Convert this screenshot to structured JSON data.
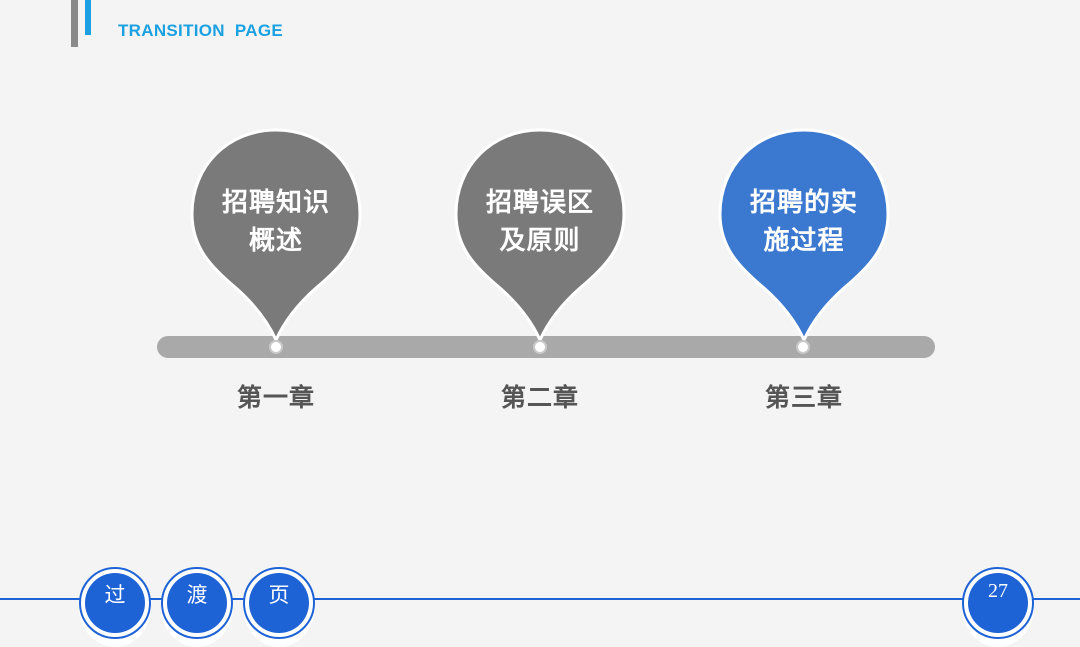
{
  "header": {
    "title": "TRANSITION  PAGE"
  },
  "colors": {
    "accent": "#1ba1e2",
    "primary": "#1e63d6",
    "pin_gray": "#7a7a7a",
    "pin_active": "#3b78cf",
    "timeline": "#a9a9a9"
  },
  "milestones": [
    {
      "line1": "招聘知识",
      "line2": "概述",
      "chapter": "第一章",
      "active": false
    },
    {
      "line1": "招聘误区",
      "line2": "及原则",
      "chapter": "第二章",
      "active": false
    },
    {
      "line1": "招聘的实",
      "line2": "施过程",
      "chapter": "第三章",
      "active": true
    }
  ],
  "footer": {
    "tabs": [
      "过",
      "渡",
      "页"
    ],
    "page_number": "27"
  }
}
